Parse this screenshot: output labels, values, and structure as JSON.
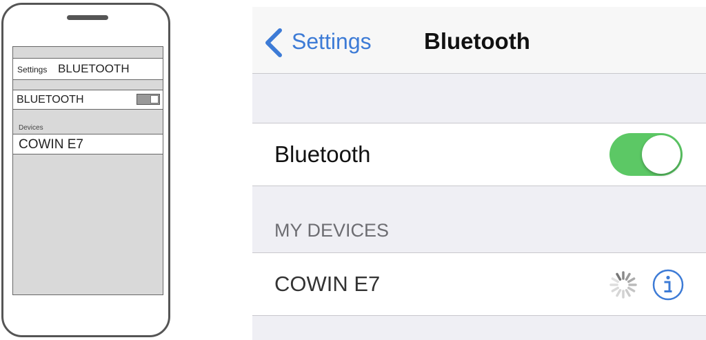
{
  "phone_illustration": {
    "header": {
      "back_label": "Settings",
      "title": "BLUETOOTH"
    },
    "toggle_row": {
      "label": "BLUETOOTH",
      "state": "on"
    },
    "section_label": "Devices",
    "device": {
      "name": "COWIN E7"
    }
  },
  "ios_screen": {
    "navbar": {
      "back_label": "Settings",
      "title": "Bluetooth"
    },
    "bluetooth_row": {
      "label": "Bluetooth",
      "enabled": true
    },
    "section_header": "MY DEVICES",
    "device": {
      "name": "COWIN E7",
      "status": "connecting"
    }
  },
  "icons": {
    "back": "chevron-left-icon",
    "spinner": "loading-spinner-icon",
    "info": "info-icon"
  },
  "colors": {
    "accent": "#3d7bd6",
    "switch_on": "#5cc865",
    "background": "#efeff4",
    "section_text": "#6d6d72"
  }
}
